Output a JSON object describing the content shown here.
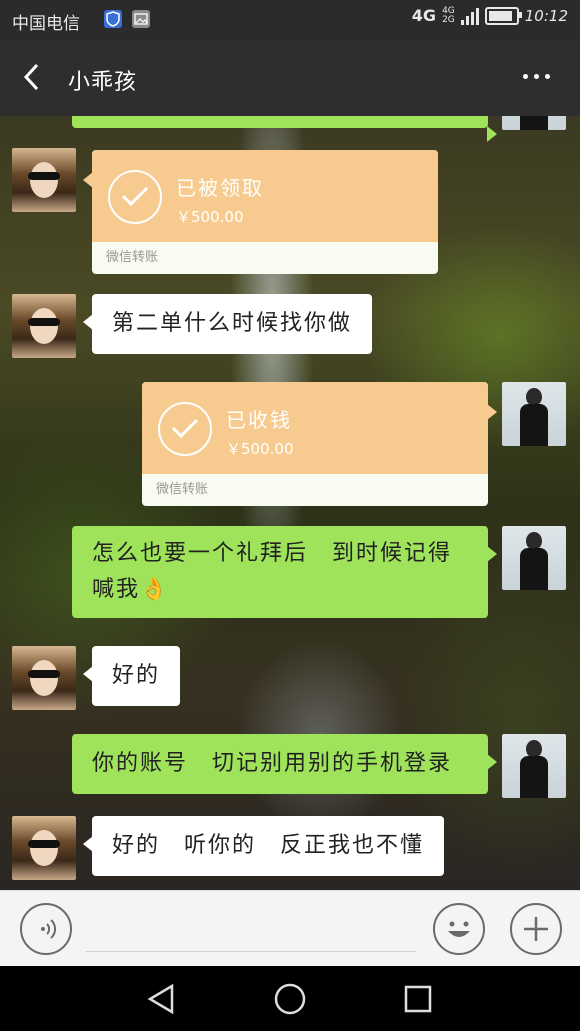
{
  "status_bar": {
    "carrier": "中国电信",
    "network": "4G",
    "network_alt": [
      "4G",
      "2G"
    ],
    "time": "10:12",
    "battery_level": 0.9
  },
  "title_bar": {
    "title": "小乖孩",
    "back_icon": "chevron-left-icon",
    "more_icon": "more-dots-icon"
  },
  "messages": [
    {
      "side": "right",
      "type": "text",
      "text": ""
    },
    {
      "side": "left",
      "type": "transfer",
      "status": "已被领取",
      "amount": "￥500.00",
      "footer": "微信转账"
    },
    {
      "side": "left",
      "type": "text",
      "text": "第二单什么时候找你做"
    },
    {
      "side": "right",
      "type": "transfer",
      "status": "已收钱",
      "amount": "￥500.00",
      "footer": "微信转账"
    },
    {
      "side": "right",
      "type": "text",
      "text": "怎么也要一个礼拜后　到时候记得喊我",
      "emoji": "👌"
    },
    {
      "side": "left",
      "type": "text",
      "text": "好的"
    },
    {
      "side": "right",
      "type": "text",
      "text": "你的账号　切记别用别的手机登录"
    },
    {
      "side": "left",
      "type": "text",
      "text": "好的　听你的　反正我也不懂"
    }
  ],
  "input_bar": {
    "voice_icon": "voice-icon",
    "emoji_icon": "smiley-icon",
    "add_icon": "plus-icon"
  },
  "nav_bar": {
    "back_icon": "triangle-back-icon",
    "home_icon": "circle-home-icon",
    "recents_icon": "square-recents-icon"
  },
  "colors": {
    "own_bubble": "#9ee35a",
    "other_bubble": "#ffffff",
    "transfer": "#f7cb8f",
    "title_bar": "#2e2e2e"
  }
}
